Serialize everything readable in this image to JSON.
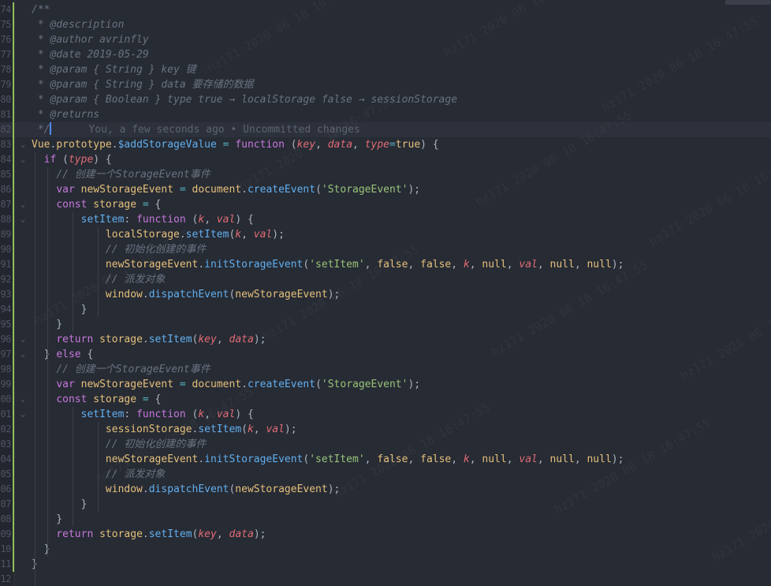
{
  "editor": {
    "accent": "#528bff",
    "modified_bar_color": "#8fbd58",
    "blame_text": "You, a few seconds ago • Uncommitted changes",
    "watermark_lines": [
      "hz171  2020 06 18  16:47:55"
    ],
    "lines": [
      {
        "n": "74",
        "fold": "",
        "tokens": [
          [
            "c",
            "/**"
          ]
        ]
      },
      {
        "n": "75",
        "fold": "",
        "tokens": [
          [
            "c",
            " * @description"
          ]
        ]
      },
      {
        "n": "76",
        "fold": "",
        "tokens": [
          [
            "c",
            " * @author avrinfly"
          ]
        ]
      },
      {
        "n": "77",
        "fold": "",
        "tokens": [
          [
            "c",
            " * @date 2019-05-29"
          ]
        ]
      },
      {
        "n": "78",
        "fold": "",
        "tokens": [
          [
            "c",
            " * @param { String } key 键"
          ]
        ]
      },
      {
        "n": "79",
        "fold": "",
        "tokens": [
          [
            "c",
            " * @param { String } data 要存储的数据"
          ]
        ]
      },
      {
        "n": "80",
        "fold": "",
        "tokens": [
          [
            "c",
            " * @param { Boolean } type true → localStorage false → sessionStorage"
          ]
        ]
      },
      {
        "n": "81",
        "fold": "",
        "tokens": [
          [
            "c",
            " * @returns"
          ]
        ]
      },
      {
        "n": "82",
        "fold": "",
        "cursor": true,
        "tokens": [
          [
            "c",
            " */"
          ]
        ]
      },
      {
        "n": "83",
        "fold": "",
        "tokens": [
          [
            "d",
            "Vue"
          ],
          [
            "pl",
            "."
          ],
          [
            "d",
            "prototype"
          ],
          [
            "pl",
            "."
          ],
          [
            "f",
            "$addStorageValue"
          ],
          [
            "pl",
            " "
          ],
          [
            "o",
            "="
          ],
          [
            "pl",
            " "
          ],
          [
            "k",
            "function"
          ],
          [
            "pl",
            " ("
          ],
          [
            "pa",
            "key"
          ],
          [
            "pl",
            ", "
          ],
          [
            "pa",
            "data"
          ],
          [
            "pl",
            ", "
          ],
          [
            "pa",
            "type"
          ],
          [
            "o",
            "="
          ],
          [
            "d",
            "true"
          ],
          [
            "pl",
            ") {"
          ]
        ]
      },
      {
        "n": "84",
        "fold": "",
        "tokens": [
          [
            "pl",
            "  "
          ],
          [
            "k",
            "if"
          ],
          [
            "pl",
            " ("
          ],
          [
            "pa",
            "type"
          ],
          [
            "pl",
            ") {"
          ]
        ]
      },
      {
        "n": "85",
        "fold": "",
        "tokens": [
          [
            "pl",
            "    "
          ],
          [
            "c",
            "// 创建一个StorageEvent事件"
          ]
        ]
      },
      {
        "n": "86",
        "fold": "",
        "tokens": [
          [
            "pl",
            "    "
          ],
          [
            "k",
            "var"
          ],
          [
            "pl",
            " "
          ],
          [
            "v",
            "newStorageEvent"
          ],
          [
            "pl",
            " "
          ],
          [
            "o",
            "="
          ],
          [
            "pl",
            " "
          ],
          [
            "v",
            "document"
          ],
          [
            "pl",
            "."
          ],
          [
            "f",
            "createEvent"
          ],
          [
            "pl",
            "("
          ],
          [
            "s",
            "'StorageEvent'"
          ],
          [
            "pl",
            ");"
          ]
        ]
      },
      {
        "n": "87",
        "fold": "",
        "tokens": [
          [
            "pl",
            "    "
          ],
          [
            "k",
            "const"
          ],
          [
            "pl",
            " "
          ],
          [
            "v",
            "storage"
          ],
          [
            "pl",
            " "
          ],
          [
            "o",
            "="
          ],
          [
            "pl",
            " {"
          ]
        ]
      },
      {
        "n": "88",
        "fold": "",
        "tokens": [
          [
            "pl",
            "        "
          ],
          [
            "f",
            "setItem"
          ],
          [
            "pl",
            ": "
          ],
          [
            "k",
            "function"
          ],
          [
            "pl",
            " ("
          ],
          [
            "pa",
            "k"
          ],
          [
            "pl",
            ", "
          ],
          [
            "pa",
            "val"
          ],
          [
            "pl",
            ") {"
          ]
        ]
      },
      {
        "n": "89",
        "fold": "",
        "tokens": [
          [
            "pl",
            "            "
          ],
          [
            "v",
            "localStorage"
          ],
          [
            "pl",
            "."
          ],
          [
            "f",
            "setItem"
          ],
          [
            "pl",
            "("
          ],
          [
            "pa",
            "k"
          ],
          [
            "pl",
            ", "
          ],
          [
            "pa",
            "val"
          ],
          [
            "pl",
            ");"
          ]
        ]
      },
      {
        "n": "90",
        "fold": "",
        "tokens": [
          [
            "pl",
            "            "
          ],
          [
            "c",
            "// 初始化创建的事件"
          ]
        ]
      },
      {
        "n": "91",
        "fold": "",
        "tokens": [
          [
            "pl",
            "            "
          ],
          [
            "v",
            "newStorageEvent"
          ],
          [
            "pl",
            "."
          ],
          [
            "f",
            "initStorageEvent"
          ],
          [
            "pl",
            "("
          ],
          [
            "s",
            "'setItem'"
          ],
          [
            "pl",
            ", "
          ],
          [
            "d",
            "false"
          ],
          [
            "pl",
            ", "
          ],
          [
            "d",
            "false"
          ],
          [
            "pl",
            ", "
          ],
          [
            "pa",
            "k"
          ],
          [
            "pl",
            ", "
          ],
          [
            "d",
            "null"
          ],
          [
            "pl",
            ", "
          ],
          [
            "pa",
            "val"
          ],
          [
            "pl",
            ", "
          ],
          [
            "d",
            "null"
          ],
          [
            "pl",
            ", "
          ],
          [
            "d",
            "null"
          ],
          [
            "pl",
            ");"
          ]
        ]
      },
      {
        "n": "92",
        "fold": "",
        "tokens": [
          [
            "pl",
            "            "
          ],
          [
            "c",
            "// 派发对象"
          ]
        ]
      },
      {
        "n": "93",
        "fold": "",
        "tokens": [
          [
            "pl",
            "            "
          ],
          [
            "v",
            "window"
          ],
          [
            "pl",
            "."
          ],
          [
            "f",
            "dispatchEvent"
          ],
          [
            "pl",
            "("
          ],
          [
            "v",
            "newStorageEvent"
          ],
          [
            "pl",
            ");"
          ]
        ]
      },
      {
        "n": "94",
        "fold": "",
        "tokens": [
          [
            "pl",
            "        }"
          ]
        ]
      },
      {
        "n": "95",
        "fold": "",
        "tokens": [
          [
            "pl",
            "    }"
          ]
        ]
      },
      {
        "n": "96",
        "fold": "",
        "tokens": [
          [
            "pl",
            "    "
          ],
          [
            "k",
            "return"
          ],
          [
            "pl",
            " "
          ],
          [
            "v",
            "storage"
          ],
          [
            "pl",
            "."
          ],
          [
            "f",
            "setItem"
          ],
          [
            "pl",
            "("
          ],
          [
            "pa",
            "key"
          ],
          [
            "pl",
            ", "
          ],
          [
            "pa",
            "data"
          ],
          [
            "pl",
            ");"
          ]
        ]
      },
      {
        "n": "97",
        "fold": "",
        "tokens": [
          [
            "pl",
            "  } "
          ],
          [
            "k",
            "else"
          ],
          [
            "pl",
            " {"
          ]
        ]
      },
      {
        "n": "98",
        "fold": "",
        "tokens": [
          [
            "pl",
            "    "
          ],
          [
            "c",
            "// 创建一个StorageEvent事件"
          ]
        ]
      },
      {
        "n": "99",
        "fold": "",
        "tokens": [
          [
            "pl",
            "    "
          ],
          [
            "k",
            "var"
          ],
          [
            "pl",
            " "
          ],
          [
            "v",
            "newStorageEvent"
          ],
          [
            "pl",
            " "
          ],
          [
            "o",
            "="
          ],
          [
            "pl",
            " "
          ],
          [
            "v",
            "document"
          ],
          [
            "pl",
            "."
          ],
          [
            "f",
            "createEvent"
          ],
          [
            "pl",
            "("
          ],
          [
            "s",
            "'StorageEvent'"
          ],
          [
            "pl",
            ");"
          ]
        ]
      },
      {
        "n": "00",
        "fold": "",
        "tokens": [
          [
            "pl",
            "    "
          ],
          [
            "k",
            "const"
          ],
          [
            "pl",
            " "
          ],
          [
            "v",
            "storage"
          ],
          [
            "pl",
            " "
          ],
          [
            "o",
            "="
          ],
          [
            "pl",
            " {"
          ]
        ]
      },
      {
        "n": "01",
        "fold": "",
        "tokens": [
          [
            "pl",
            "        "
          ],
          [
            "f",
            "setItem"
          ],
          [
            "pl",
            ": "
          ],
          [
            "k",
            "function"
          ],
          [
            "pl",
            " ("
          ],
          [
            "pa",
            "k"
          ],
          [
            "pl",
            ", "
          ],
          [
            "pa",
            "val"
          ],
          [
            "pl",
            ") {"
          ]
        ]
      },
      {
        "n": "02",
        "fold": "",
        "tokens": [
          [
            "pl",
            "            "
          ],
          [
            "v",
            "sessionStorage"
          ],
          [
            "pl",
            "."
          ],
          [
            "f",
            "setItem"
          ],
          [
            "pl",
            "("
          ],
          [
            "pa",
            "k"
          ],
          [
            "pl",
            ", "
          ],
          [
            "pa",
            "val"
          ],
          [
            "pl",
            ");"
          ]
        ]
      },
      {
        "n": "03",
        "fold": "",
        "tokens": [
          [
            "pl",
            "            "
          ],
          [
            "c",
            "// 初始化创建的事件"
          ]
        ]
      },
      {
        "n": "04",
        "fold": "",
        "tokens": [
          [
            "pl",
            "            "
          ],
          [
            "v",
            "newStorageEvent"
          ],
          [
            "pl",
            "."
          ],
          [
            "f",
            "initStorageEvent"
          ],
          [
            "pl",
            "("
          ],
          [
            "s",
            "'setItem'"
          ],
          [
            "pl",
            ", "
          ],
          [
            "d",
            "false"
          ],
          [
            "pl",
            ", "
          ],
          [
            "d",
            "false"
          ],
          [
            "pl",
            ", "
          ],
          [
            "pa",
            "k"
          ],
          [
            "pl",
            ", "
          ],
          [
            "d",
            "null"
          ],
          [
            "pl",
            ", "
          ],
          [
            "pa",
            "val"
          ],
          [
            "pl",
            ", "
          ],
          [
            "d",
            "null"
          ],
          [
            "pl",
            ", "
          ],
          [
            "d",
            "null"
          ],
          [
            "pl",
            ");"
          ]
        ]
      },
      {
        "n": "05",
        "fold": "",
        "tokens": [
          [
            "pl",
            "            "
          ],
          [
            "c",
            "// 派发对象"
          ]
        ]
      },
      {
        "n": "06",
        "fold": "",
        "tokens": [
          [
            "pl",
            "            "
          ],
          [
            "v",
            "window"
          ],
          [
            "pl",
            "."
          ],
          [
            "f",
            "dispatchEvent"
          ],
          [
            "pl",
            "("
          ],
          [
            "v",
            "newStorageEvent"
          ],
          [
            "pl",
            ");"
          ]
        ]
      },
      {
        "n": "07",
        "fold": "",
        "tokens": [
          [
            "pl",
            "        }"
          ]
        ]
      },
      {
        "n": "08",
        "fold": "",
        "tokens": [
          [
            "pl",
            "    }"
          ]
        ]
      },
      {
        "n": "09",
        "fold": "",
        "tokens": [
          [
            "pl",
            "    "
          ],
          [
            "k",
            "return"
          ],
          [
            "pl",
            " "
          ],
          [
            "v",
            "storage"
          ],
          [
            "pl",
            "."
          ],
          [
            "f",
            "setItem"
          ],
          [
            "pl",
            "("
          ],
          [
            "pa",
            "key"
          ],
          [
            "pl",
            ", "
          ],
          [
            "pa",
            "data"
          ],
          [
            "pl",
            ");"
          ]
        ]
      },
      {
        "n": "10",
        "fold": "",
        "tokens": [
          [
            "pl",
            "  }"
          ]
        ]
      },
      {
        "n": "11",
        "fold": "",
        "tokens": [
          [
            "pl",
            "}"
          ]
        ]
      },
      {
        "n": "12",
        "fold": "",
        "tokens": []
      }
    ]
  }
}
